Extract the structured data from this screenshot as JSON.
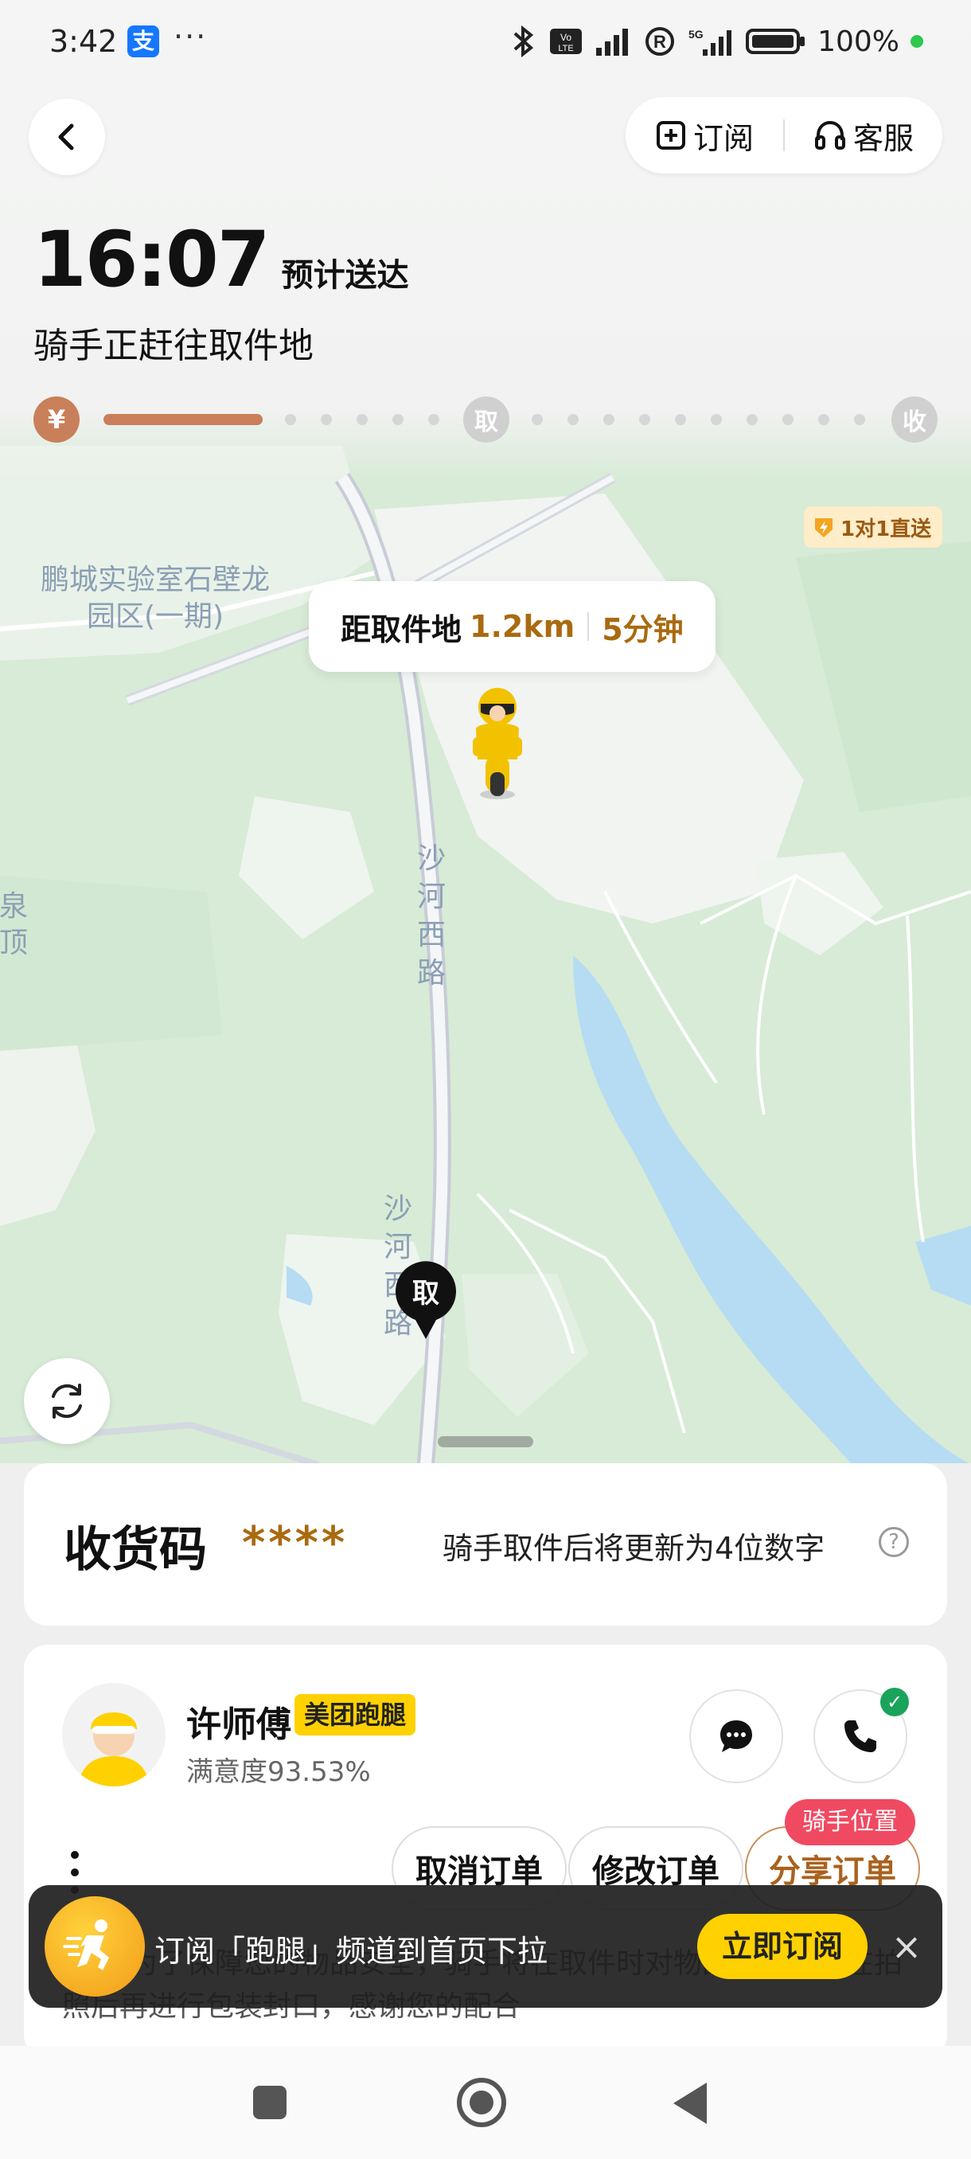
{
  "status_bar": {
    "time": "3:42",
    "alipay_icon": "支",
    "more": "···",
    "battery": "100%",
    "icons": [
      "bluetooth-icon",
      "volte-icon",
      "signal-icon",
      "r-icon",
      "5g-signal-icon",
      "battery-icon"
    ]
  },
  "header": {
    "subscribe_label": "订阅",
    "service_label": "客服"
  },
  "eta": {
    "time": "16:07",
    "label": "预计送达",
    "status": "骑手正赶往取件地"
  },
  "progress": {
    "start_symbol": "¥",
    "pickup_label": "取",
    "end_label": "收",
    "filled_fraction": 0.18
  },
  "map": {
    "badge": "1对1直送",
    "poi_1": "鹏城实验室石壁龙\n园区(一期)",
    "poi_2": "泉顶",
    "road_1": [
      "沙",
      "河",
      "西",
      "路"
    ],
    "road_2": [
      "沙",
      "河",
      "西",
      "路"
    ],
    "distance_prefix": "距取件地",
    "distance": "1.2km",
    "eta_minutes": "5分钟",
    "pickup_pin": "取"
  },
  "code_card": {
    "title": "收货码",
    "masked_code": "****",
    "hint": "骑手取件后将更新为4位数字",
    "help": "?"
  },
  "rider": {
    "name": "许师傅",
    "badge": "美团跑腿",
    "rating": "满意度93.53%",
    "position_tag": "骑手位置",
    "actions": {
      "cancel": "取消订单",
      "modify": "修改订单",
      "share": "分享订单"
    },
    "notice": "为了保障您的物品安全，骑手将在取件时对物品拍照，请在拍照后再进行包装封口，感谢您的配合"
  },
  "toast": {
    "text": "订阅「跑腿」频道到首页下拉",
    "button": "立即订阅",
    "close": "×"
  },
  "colors": {
    "accent_brown": "#c9805a",
    "brand_yellow": "#ffd100",
    "gold_text": "#a96a10",
    "alert_red": "#f04a62"
  }
}
